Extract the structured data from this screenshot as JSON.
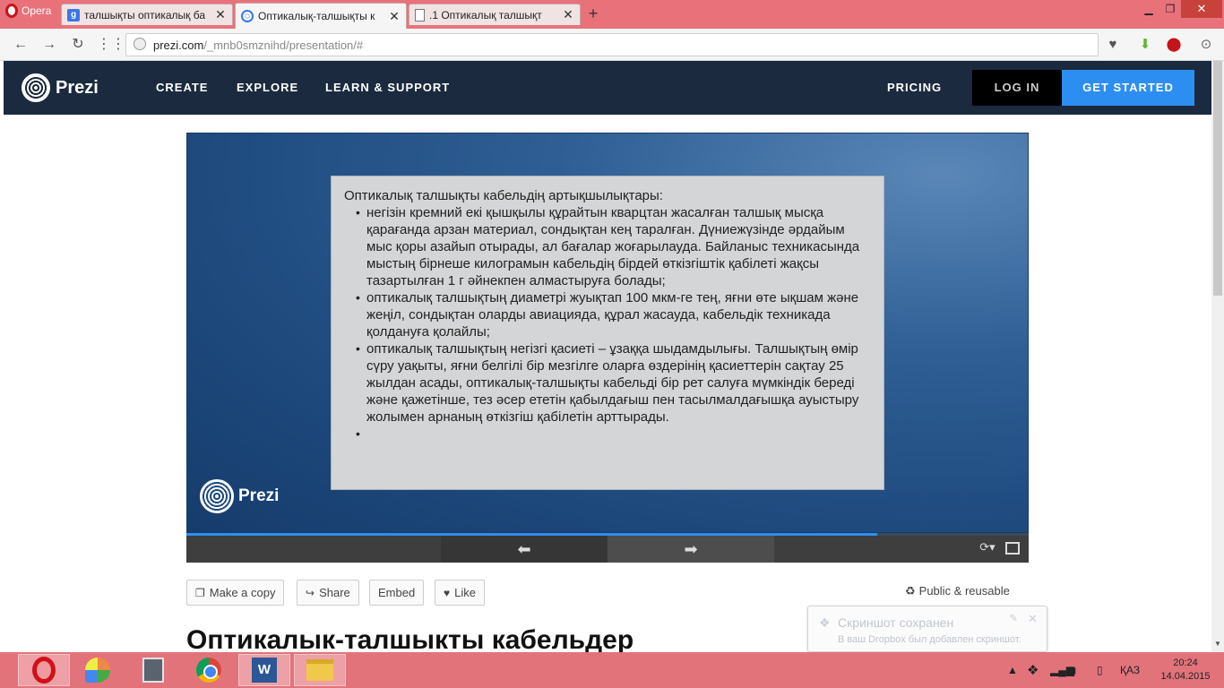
{
  "browser": {
    "menu_label": "Opera",
    "tabs": [
      {
        "label": "талшықты оптикалық ба",
        "icon": "google-favicon",
        "active": false
      },
      {
        "label": "Оптикалық-талшықты к",
        "icon": "prezi-favicon",
        "active": true
      },
      {
        "label": ".1 Оптикалық талшықт",
        "icon": "document-favicon",
        "active": false
      }
    ],
    "new_tab": "+",
    "url_host": "prezi.com",
    "url_path": "/_mnb0smznihd/presentation/#"
  },
  "header": {
    "logo": "Prezi",
    "nav": [
      "CREATE",
      "EXPLORE",
      "LEARN & SUPPORT"
    ],
    "pricing": "PRICING",
    "login": "LOG IN",
    "get_started": "GET STARTED"
  },
  "slide": {
    "heading": "Оптикалық талшықты кабельдің артықшылықтары:",
    "bullets": [
      "негізін кремний екі қышқылы құрайтын кварцтан жасалған талшық мысқа қарағанда арзан материал, сондықтан кең таралған. Дүниежүзінде әрдайым мыс қоры азайып отырады, ал бағалар жоғарылауда. Байланыс техникасында мыстың бірнеше килограмын кабельдің бірдей өткізгіштік қабілеті жақсы тазартылған 1 г әйнекпен алмастыруға болады;",
      "оптикалық талшықтың диаметрі жуықтап 100 мкм-ге тең, яғни өте ықшам және жеңіл, сондықтан оларды авиацияда, құрал жасауда, кабельдік техникада қолдануға қолайлы;",
      "оптикалық талшықтың негізгі қасиеті – ұзаққа шыдамдылығы. Талшықтың  өмір сүру уақыты, яғни белгілі бір мезгілге оларға өздерінің қасиеттерін сақтау 25 жылдан асады, оптикалық-талшықты кабельді бір рет салуға мүмкіндік береді және қажетінше, тез әсер ететін қабылдағыш пен тасылмалдағышқа ауыстыру жолымен арнаның өткізгіш қабілетін арттырады.",
      ""
    ],
    "watermark": "Prezi",
    "progress": 0.82
  },
  "actions": {
    "copy": "Make a copy",
    "share": "Share",
    "embed": "Embed",
    "like": "Like",
    "public": "Public & reusable"
  },
  "presentation_title": "Оптикалык-талшыкты кабельдер",
  "notification": {
    "title": "Скриншот сохранен",
    "body": "В ваш Dropbox был добавлен скриншот."
  },
  "taskbar": {
    "language": "ҚАЗ",
    "time": "20:24",
    "date": "14.04.2015"
  },
  "colors": {
    "tab_bar": "#e8717a",
    "prezi_header": "#1b2a3e",
    "accent": "#2d8ef1",
    "slide_bg": "#d3d5d6",
    "taskbar": "#e2737b"
  }
}
